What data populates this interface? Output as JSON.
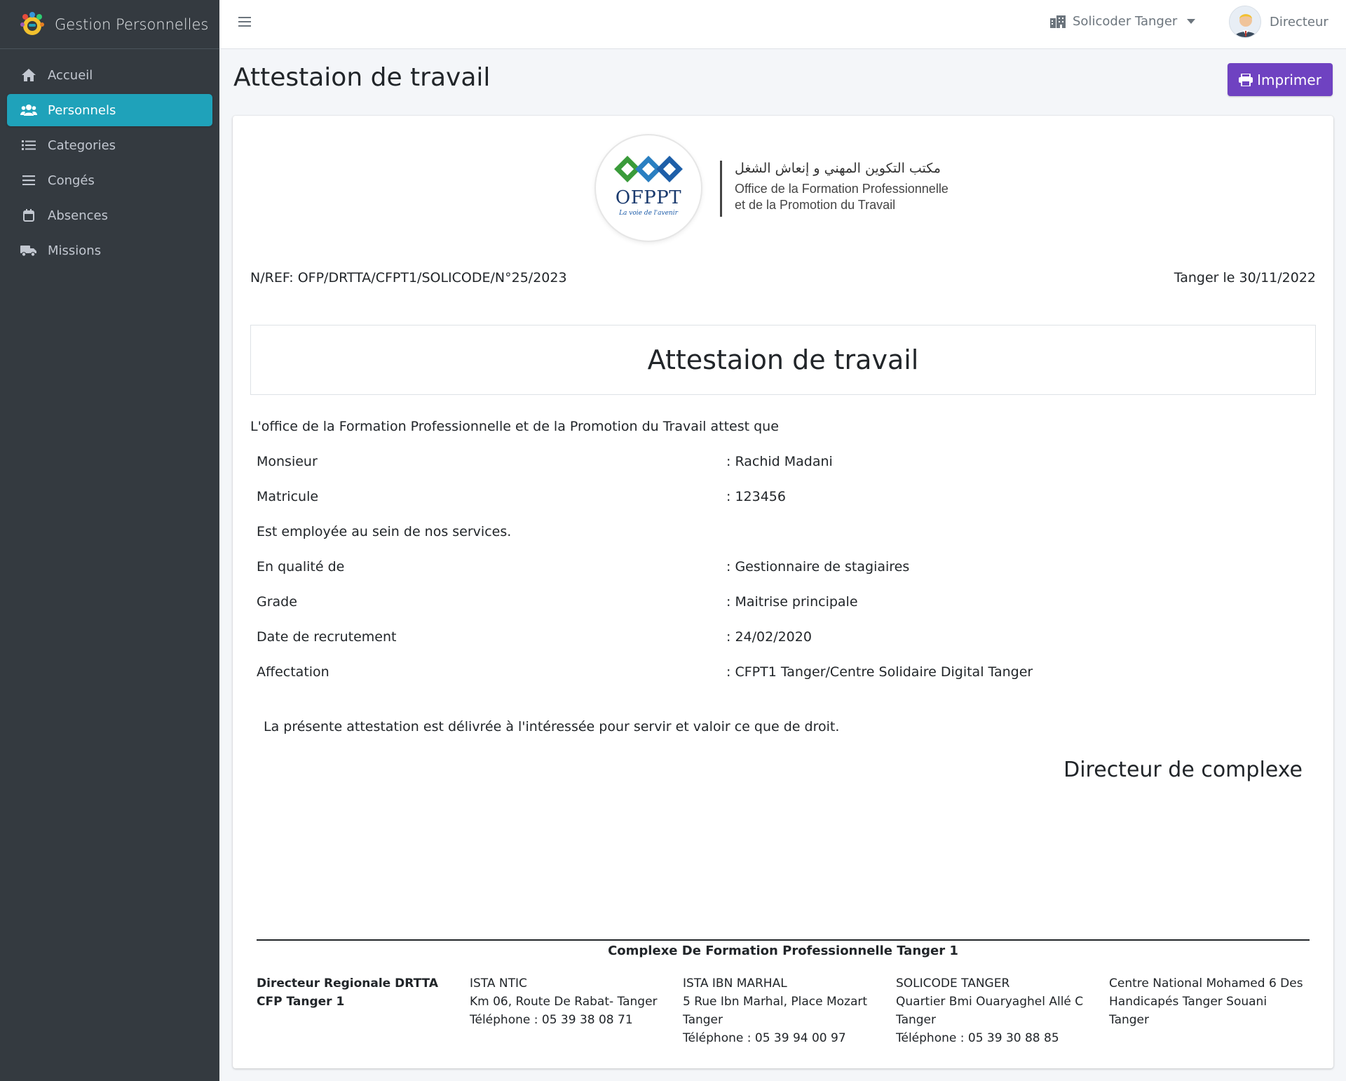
{
  "app": {
    "title": "Gestion Personnelles"
  },
  "sidebar": {
    "items": [
      {
        "label": "Accueil",
        "icon": "home-icon"
      },
      {
        "label": "Personnels",
        "icon": "users-icon",
        "active": true
      },
      {
        "label": "Categories",
        "icon": "list-icon"
      },
      {
        "label": "Congés",
        "icon": "bars-icon"
      },
      {
        "label": "Absences",
        "icon": "calendar-icon"
      },
      {
        "label": "Missions",
        "icon": "truck-icon"
      }
    ]
  },
  "topbar": {
    "organization": "Solicoder Tanger",
    "user_role": "Directeur"
  },
  "page": {
    "title": "Attestaion de travail",
    "print_label": "Imprimer"
  },
  "document": {
    "office_arabic": "مكتب التكوين المهني و إنعاش الشغل",
    "office_fr_line1": "Office de la Formation Professionnelle",
    "office_fr_line2": "et de la Promotion du Travail",
    "logo_text": "OFPPT",
    "logo_tagline": "La voie de l'avenir",
    "reference": "N/REF: OFP/DRTTA/CFPT1/SOLICODE/N°25/2023",
    "date": "Tanger le 30/11/2022",
    "title": "Attestaion de travail",
    "intro": "L'office de la Formation Professionnelle et de la Promotion du Travail attest que",
    "fields": [
      {
        "label": "Monsieur",
        "value": ": Rachid Madani"
      },
      {
        "label": "Matricule",
        "value": ": 123456"
      },
      {
        "label": "Est employée au sein de nos services.",
        "value": ""
      },
      {
        "label": "En qualité de",
        "value": ": Gestionnaire de stagiaires"
      },
      {
        "label": "Grade",
        "value": ": Maitrise principale"
      },
      {
        "label": "Date de recrutement",
        "value": ": 24/02/2020"
      },
      {
        "label": "Affectation",
        "value": ": CFPT1 Tanger/Centre Solidaire Digital Tanger"
      }
    ],
    "closing": "La présente attestation est délivrée à l'intéressée pour servir et valoir ce que de droit.",
    "signer": "Directeur de complexe",
    "footer": {
      "title": "Complexe De Formation Professionnelle Tanger 1",
      "columns": [
        {
          "line1": "Directeur Regionale DRTTA",
          "line2": "CFP Tanger 1",
          "line3": "",
          "line4": ""
        },
        {
          "line1": "ISTA NTIC",
          "line2": "Km 06, Route De Rabat- Tanger",
          "line3": "Téléphone : 05 39 38 08 71",
          "line4": ""
        },
        {
          "line1": "ISTA IBN MARHAL",
          "line2": "5 Rue Ibn Marhal, Place Mozart",
          "line3": "Tanger",
          "line4": "Téléphone : 05 39 94 00 97"
        },
        {
          "line1": "SOLICODE TANGER",
          "line2": "Quartier Bmi Ouaryaghel Allé C",
          "line3": "Tanger",
          "line4": "Téléphone : 05 39 30 88 85"
        },
        {
          "line1": "Centre National Mohamed 6 Des",
          "line2": "Handicapés Tanger Souani",
          "line3": "Tanger",
          "line4": ""
        }
      ]
    }
  },
  "colors": {
    "sidebar_bg": "#343a40",
    "active_item": "#1fa2ba",
    "print_button": "#6f42c1"
  }
}
